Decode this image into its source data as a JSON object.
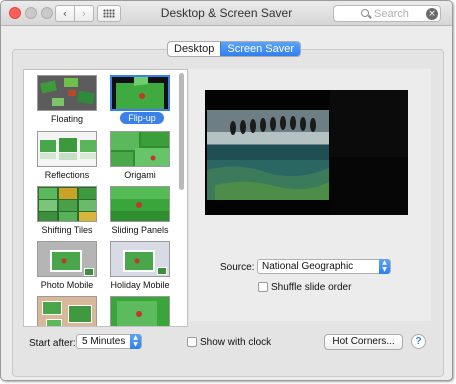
{
  "window": {
    "title": "Desktop & Screen Saver",
    "nav_back": "‹",
    "nav_forward": "›",
    "search_placeholder": "Search",
    "search_clear": "×"
  },
  "tabs": [
    {
      "label": "Desktop",
      "active": false
    },
    {
      "label": "Screen Saver",
      "active": true
    }
  ],
  "screensavers": [
    {
      "label": "Floating",
      "selected": false
    },
    {
      "label": "Flip-up",
      "selected": true
    },
    {
      "label": "Reflections",
      "selected": false
    },
    {
      "label": "Origami",
      "selected": false
    },
    {
      "label": "Shifting Tiles",
      "selected": false
    },
    {
      "label": "Sliding Panels",
      "selected": false
    },
    {
      "label": "Photo Mobile",
      "selected": false
    },
    {
      "label": "Holiday Mobile",
      "selected": false
    }
  ],
  "options": {
    "source_label": "Source:",
    "source_value": "National Geographic",
    "shuffle_label": "Shuffle slide order",
    "shuffle_checked": false
  },
  "footer": {
    "start_after_label": "Start after:",
    "start_after_value": "5 Minutes",
    "show_clock_label": "Show with clock",
    "show_clock_checked": false,
    "hot_corners_label": "Hot Corners...",
    "help_label": "?"
  },
  "colors": {
    "accent": "#3a80e8",
    "close": "#fc5f57",
    "thumb_green": "#4caf50"
  },
  "icons": [
    "grid-icon",
    "search-icon",
    "clear-icon",
    "stepper-icon",
    "help-icon"
  ]
}
